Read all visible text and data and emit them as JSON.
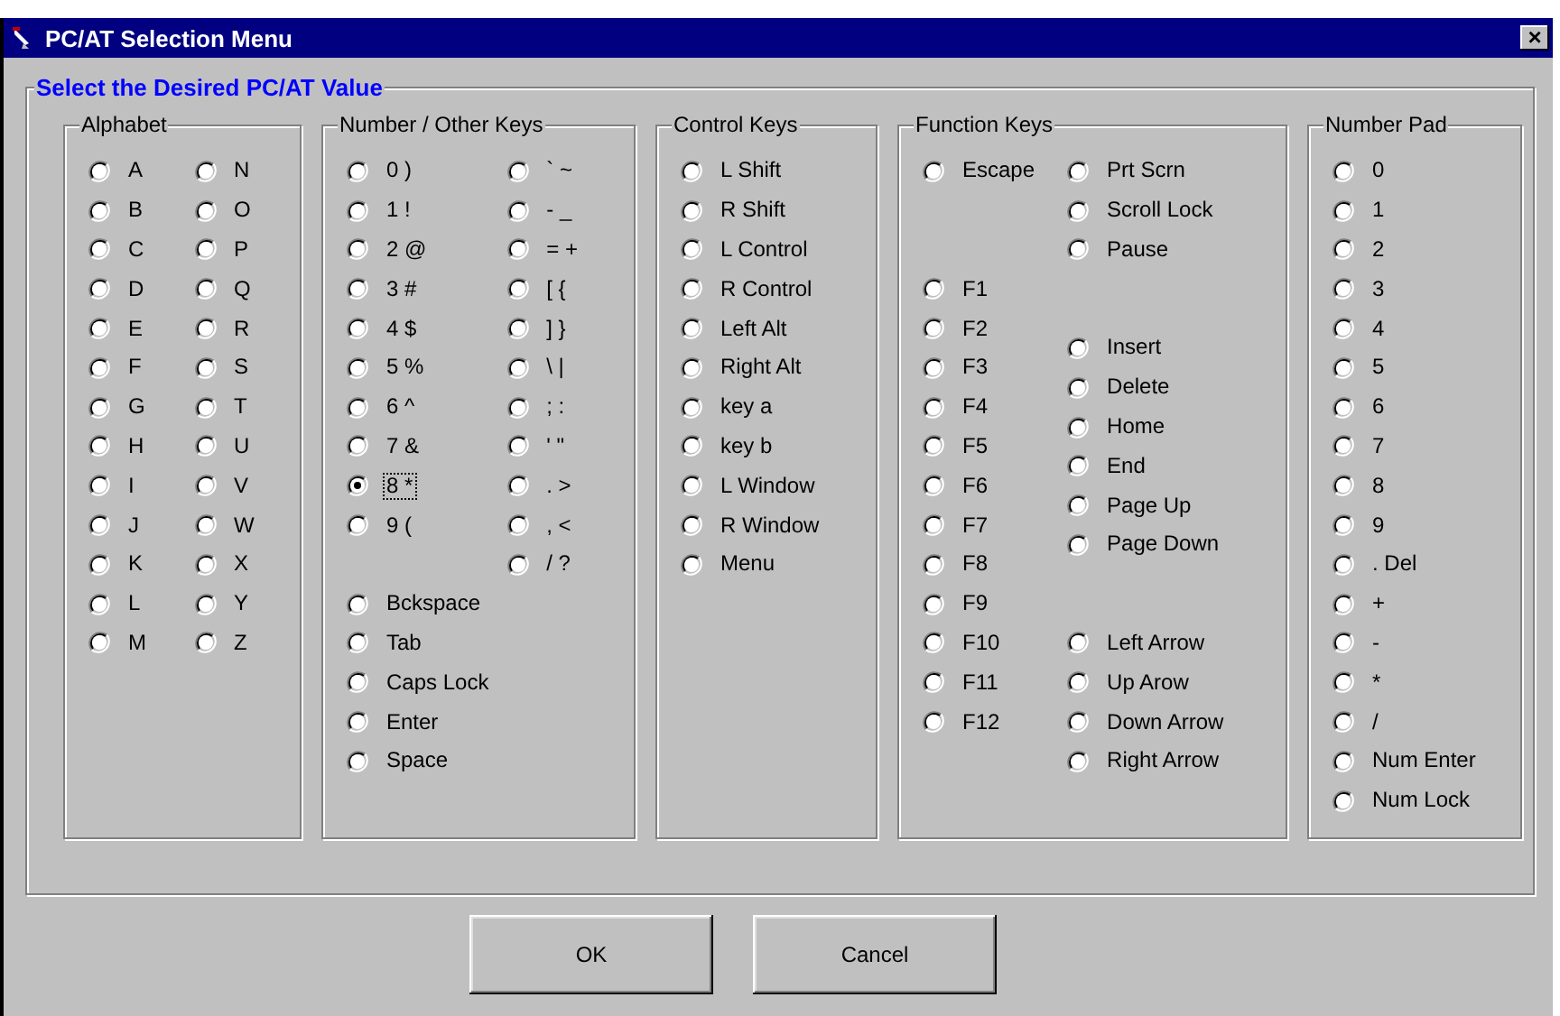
{
  "window": {
    "title": "PC/AT Selection Menu",
    "close": "×"
  },
  "section": {
    "title": "Select the Desired PC/AT Value"
  },
  "groups": [
    {
      "title": "Alphabet",
      "columns": [
        [
          [
            {
              "label": "A",
              "selected": false
            },
            {
              "label": "B",
              "selected": false
            },
            {
              "label": "C",
              "selected": false
            },
            {
              "label": "D",
              "selected": false
            },
            {
              "label": "E",
              "selected": false
            },
            {
              "label": "F",
              "selected": false
            },
            {
              "label": "G",
              "selected": false
            },
            {
              "label": "H",
              "selected": false
            },
            {
              "label": "I",
              "selected": false
            },
            {
              "label": "J",
              "selected": false
            },
            {
              "label": "K",
              "selected": false
            },
            {
              "label": "L",
              "selected": false
            },
            {
              "label": "M",
              "selected": false
            }
          ]
        ],
        [
          [
            {
              "label": "N",
              "selected": false
            },
            {
              "label": "O",
              "selected": false
            },
            {
              "label": "P",
              "selected": false
            },
            {
              "label": "Q",
              "selected": false
            },
            {
              "label": "R",
              "selected": false
            },
            {
              "label": "S",
              "selected": false
            },
            {
              "label": "T",
              "selected": false
            },
            {
              "label": "U",
              "selected": false
            },
            {
              "label": "V",
              "selected": false
            },
            {
              "label": "W",
              "selected": false
            },
            {
              "label": "X",
              "selected": false
            },
            {
              "label": "Y",
              "selected": false
            },
            {
              "label": "Z",
              "selected": false
            }
          ]
        ]
      ]
    },
    {
      "title": "Number / Other Keys",
      "columns": [
        [
          [
            {
              "label": "0 )",
              "selected": false
            },
            {
              "label": "1 !",
              "selected": false
            },
            {
              "label": "2 @",
              "selected": false
            },
            {
              "label": "3 #",
              "selected": false
            },
            {
              "label": "4 $",
              "selected": false
            },
            {
              "label": "5 %",
              "selected": false
            },
            {
              "label": "6 ^",
              "selected": false
            },
            {
              "label": "7 &",
              "selected": false
            },
            {
              "label": "8 *",
              "selected": true
            },
            {
              "label": "9 (",
              "selected": false
            }
          ]
        ],
        [
          [
            {
              "label": "` ~",
              "selected": false
            },
            {
              "label": "- _",
              "selected": false
            },
            {
              "label": "= +",
              "selected": false
            },
            {
              "label": "[ {",
              "selected": false
            },
            {
              "label": "] }",
              "selected": false
            },
            {
              "label": "\\ |",
              "selected": false
            },
            {
              "label": "; :",
              "selected": false
            },
            {
              "label": "' \"",
              "selected": false
            },
            {
              "label": ". >",
              "selected": false
            },
            {
              "label": ", <",
              "selected": false
            },
            {
              "label": "/ ?",
              "selected": false
            }
          ]
        ]
      ],
      "below": [
        {
          "label": "Bckspace",
          "selected": false
        },
        {
          "label": "Tab",
          "selected": false
        },
        {
          "label": "Caps Lock",
          "selected": false
        },
        {
          "label": "Enter",
          "selected": false
        },
        {
          "label": "Space",
          "selected": false
        }
      ]
    },
    {
      "title": "Control Keys",
      "columns": [
        [
          [
            {
              "label": "L Shift",
              "selected": false
            },
            {
              "label": "R Shift",
              "selected": false
            },
            {
              "label": "L Control",
              "selected": false
            },
            {
              "label": "R Control",
              "selected": false
            },
            {
              "label": "Left Alt",
              "selected": false
            },
            {
              "label": "Right Alt",
              "selected": false
            },
            {
              "label": "key a",
              "selected": false
            },
            {
              "label": "key b",
              "selected": false
            },
            {
              "label": "L Window",
              "selected": false
            },
            {
              "label": "R Window",
              "selected": false
            },
            {
              "label": "Menu",
              "selected": false
            }
          ]
        ]
      ]
    },
    {
      "title": "Function Keys",
      "columns": [
        [
          [
            {
              "label": "Escape",
              "selected": false
            }
          ],
          [
            {
              "label": "F1",
              "selected": false
            },
            {
              "label": "F2",
              "selected": false
            },
            {
              "label": "F3",
              "selected": false
            },
            {
              "label": "F4",
              "selected": false
            },
            {
              "label": "F5",
              "selected": false
            },
            {
              "label": "F6",
              "selected": false
            },
            {
              "label": "F7",
              "selected": false
            },
            {
              "label": "F8",
              "selected": false
            },
            {
              "label": "F9",
              "selected": false
            },
            {
              "label": "F10",
              "selected": false
            },
            {
              "label": "F11",
              "selected": false
            },
            {
              "label": "F12",
              "selected": false
            }
          ]
        ],
        [
          [
            {
              "label": "Prt Scrn",
              "selected": false
            },
            {
              "label": "Scroll Lock",
              "selected": false
            },
            {
              "label": "Pause",
              "selected": false
            }
          ],
          [
            {
              "label": "Insert",
              "selected": false
            },
            {
              "label": "Delete",
              "selected": false
            },
            {
              "label": "Home",
              "selected": false
            },
            {
              "label": "End",
              "selected": false
            },
            {
              "label": "Page Up",
              "selected": false
            },
            {
              "label": "Page Down",
              "selected": false
            }
          ],
          [
            {
              "label": "Left Arrow",
              "selected": false
            },
            {
              "label": "Up Arow",
              "selected": false
            },
            {
              "label": "Down Arrow",
              "selected": false
            },
            {
              "label": "Right Arrow",
              "selected": false
            }
          ]
        ]
      ]
    },
    {
      "title": "Number Pad",
      "columns": [
        [
          [
            {
              "label": "0",
              "selected": false
            },
            {
              "label": "1",
              "selected": false
            },
            {
              "label": "2",
              "selected": false
            },
            {
              "label": "3",
              "selected": false
            },
            {
              "label": "4",
              "selected": false
            },
            {
              "label": "5",
              "selected": false
            },
            {
              "label": "6",
              "selected": false
            },
            {
              "label": "7",
              "selected": false
            },
            {
              "label": "8",
              "selected": false
            },
            {
              "label": "9",
              "selected": false
            },
            {
              "label": ". Del",
              "selected": false
            },
            {
              "label": "+",
              "selected": false
            },
            {
              "label": "-",
              "selected": false
            },
            {
              "label": "*",
              "selected": false
            },
            {
              "label": "/",
              "selected": false
            },
            {
              "label": "Num Enter",
              "selected": false
            },
            {
              "label": "Num Lock",
              "selected": false
            }
          ]
        ]
      ]
    }
  ],
  "buttons": [
    "OK",
    "Cancel"
  ]
}
